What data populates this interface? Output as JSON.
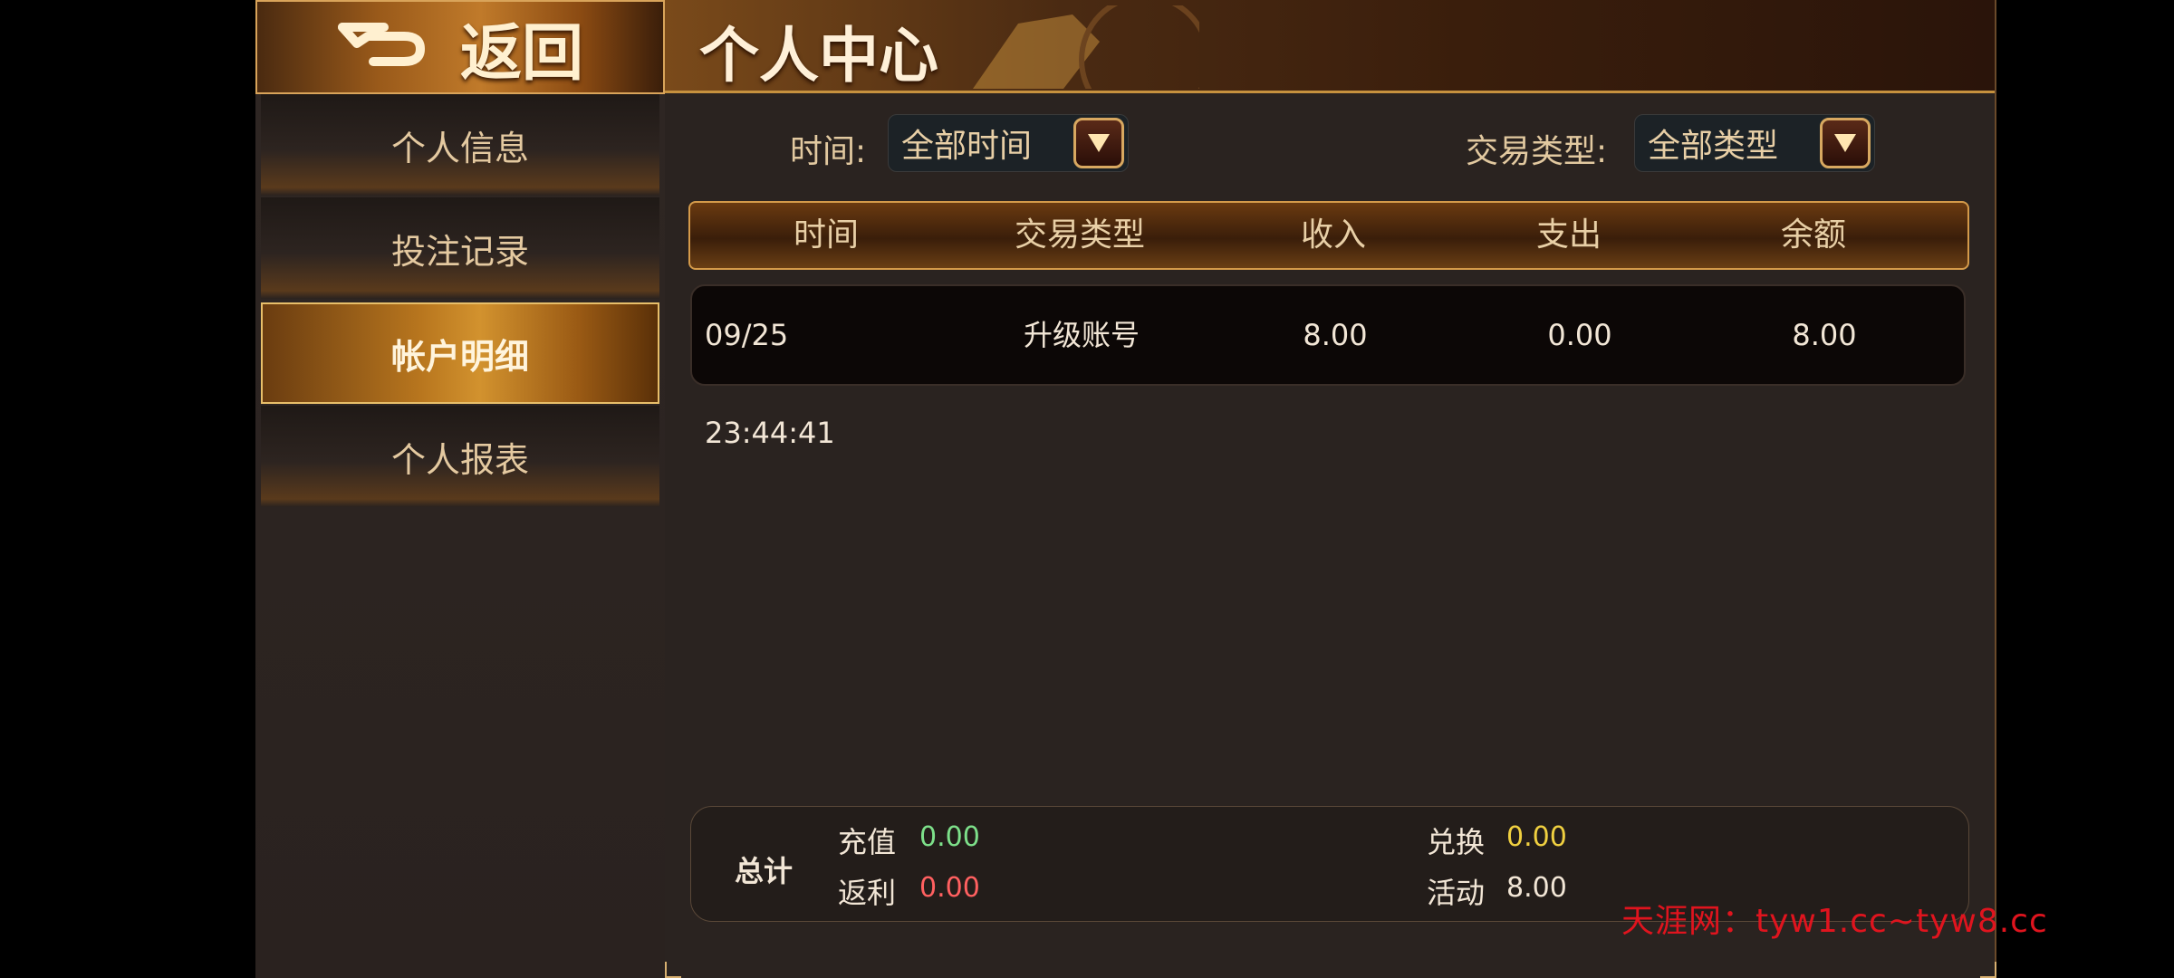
{
  "nav": {
    "back_label": "返回",
    "items": [
      {
        "label": "个人信息",
        "active": false
      },
      {
        "label": "投注记录",
        "active": false
      },
      {
        "label": "帐户明细",
        "active": true
      },
      {
        "label": "个人报表",
        "active": false
      }
    ]
  },
  "header": {
    "title": "个人中心"
  },
  "filters": {
    "time_label": "时间:",
    "time_value": "全部时间",
    "type_label": "交易类型:",
    "type_value": "全部类型"
  },
  "table": {
    "columns": [
      "时间",
      "交易类型",
      "收入",
      "支出",
      "余额"
    ],
    "rows": [
      [
        "09/25 23:44:41",
        "升级账号",
        "8.00",
        "0.00",
        "8.00"
      ]
    ]
  },
  "totals": {
    "title": "总计",
    "recharge_label": "充值",
    "recharge_value": "0.00",
    "exchange_label": "兑换",
    "exchange_value": "0.00",
    "rebate_label": "返利",
    "rebate_value": "0.00",
    "activity_label": "活动",
    "activity_value": "8.00"
  },
  "watermark": "天涯网：tyw1.cc~tyw8.cc",
  "colors": {
    "accent_gold": "#d49a4a",
    "green_value": "#7de08a",
    "yellow_value": "#f0d040",
    "red_value": "#ff6060",
    "watermark_red": "#e0141e"
  }
}
